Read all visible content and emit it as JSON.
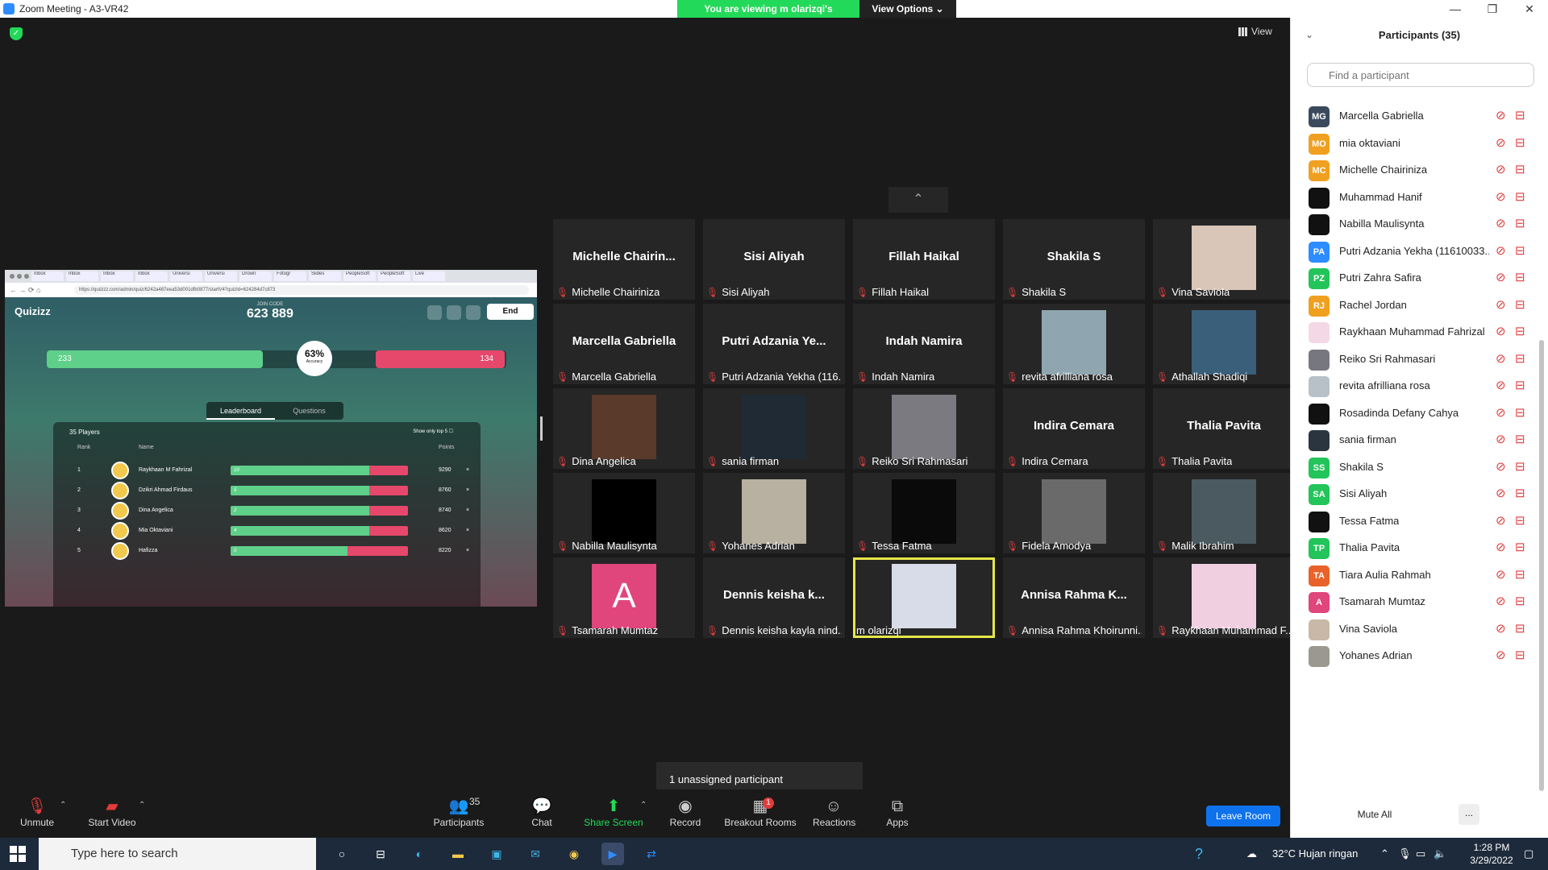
{
  "window": {
    "title": "Zoom Meeting - A3-VR42",
    "controls": [
      "—",
      "❐",
      "✕"
    ]
  },
  "banner": {
    "viewing": "You are viewing m olarizqi's screen",
    "view_options": "View Options ⌄"
  },
  "view_button": "View",
  "shared_screen": {
    "browser_tabs": [
      "Inbox",
      "Inbox",
      "Inbox",
      "Inbox",
      "Universi",
      "Universi",
      "Drown",
      "Fotogr",
      "Slides",
      "PeopleSoft",
      "PeopleSoft",
      "Live"
    ],
    "url": "https://quizizz.com/admin/quiz/6242a487eea53d001dfb0877/startV4?quizId=624284d7c873",
    "quiz": {
      "logo": "Quizizz",
      "join_label": "JOIN CODE",
      "join_code": "623 889",
      "end_label": "End",
      "correct_count": "233",
      "incorrect_count": "134",
      "accuracy": "63%",
      "accuracy_label": "Accuracy",
      "correct_fraction": 0.63,
      "tab_leaderboard": "Leaderboard",
      "tab_questions": "Questions",
      "players": "35 Players",
      "show_top5": "Show only top 5",
      "col_rank": "Rank",
      "col_name": "Name",
      "col_points": "Points",
      "rows": [
        {
          "rank": "1",
          "name": "Raykhaan M Fahrizal",
          "score": "10",
          "fraction": 0.78,
          "points": "9290",
          "x": "×"
        },
        {
          "rank": "2",
          "name": "Dzikri Ahmad Firdaus",
          "score": "5",
          "fraction": 0.78,
          "points": "8760",
          "x": "×"
        },
        {
          "rank": "3",
          "name": "Dina Angelica",
          "score": "2",
          "fraction": 0.78,
          "points": "8740",
          "x": "×"
        },
        {
          "rank": "4",
          "name": "Mia Oktaviani",
          "score": "4",
          "fraction": 0.78,
          "points": "8620",
          "x": "×"
        },
        {
          "rank": "5",
          "name": "Hafizza",
          "score": "0",
          "fraction": 0.66,
          "points": "8220",
          "x": "×"
        }
      ]
    }
  },
  "grid_up": "⌃",
  "tiles": [
    {
      "big": "Michelle  Chairin...",
      "label": "Michelle Chairiniza",
      "pic": ""
    },
    {
      "big": "Sisi Aliyah",
      "label": "Sisi Aliyah",
      "pic": ""
    },
    {
      "big": "Fillah Haikal",
      "label": "Fillah Haikal",
      "pic": ""
    },
    {
      "big": "Shakila S",
      "label": "Shakila S",
      "pic": ""
    },
    {
      "big": "",
      "label": "Vina Saviola",
      "pic": "#d9c6b8"
    },
    {
      "big": "Marcella Gabriella",
      "label": "Marcella Gabriella",
      "pic": ""
    },
    {
      "big": "Putri  Adzania  Ye...",
      "label": "Putri Adzania Yekha (116...",
      "pic": ""
    },
    {
      "big": "Indah Namira",
      "label": "Indah Namira",
      "pic": ""
    },
    {
      "big": "",
      "label": "revita afrilliana rosa",
      "pic": "#8fa6b0"
    },
    {
      "big": "",
      "label": "Athallah Shadiqi",
      "pic": "#3a5f7a"
    },
    {
      "big": "",
      "label": "Dina Angelica",
      "pic": "#5a3a2a"
    },
    {
      "big": "",
      "label": "sania firman",
      "pic": "#202a35"
    },
    {
      "big": "",
      "label": "Reiko Sri Rahmasari",
      "pic": "#7a7a80"
    },
    {
      "big": "Indira Cemara",
      "label": "Indira Cemara",
      "pic": ""
    },
    {
      "big": "Thalia Pavita",
      "label": "Thalia Pavita",
      "pic": ""
    },
    {
      "big": "",
      "label": "Nabilla Maulisynta",
      "pic": "#000000"
    },
    {
      "big": "",
      "label": "Yohanes Adrian",
      "pic": "#b8b0a0"
    },
    {
      "big": "",
      "label": "Tessa Fatma",
      "pic": "#0a0a0a"
    },
    {
      "big": "",
      "label": "Fidela Amodya",
      "pic": "#6a6a6a"
    },
    {
      "big": "",
      "label": "Malik Ibrahim",
      "pic": "#4a5a60"
    },
    {
      "big": "",
      "label": "Tsamarah Mumtaz",
      "pic": "#e0457b",
      "letter": "A"
    },
    {
      "big": "Dennis  keisha  k...",
      "label": "Dennis keisha kayla nind...",
      "pic": ""
    },
    {
      "big": "",
      "label": "m olarizqi",
      "pic": "#d8dce8",
      "active": true
    },
    {
      "big": "Annisa  Rahma  K...",
      "label": "Annisa Rahma Khoirunni...",
      "pic": ""
    },
    {
      "big": "",
      "label": "Raykhaan Muhammad F...",
      "pic": "#f0d0e0"
    }
  ],
  "notice": "1 unassigned participant",
  "toolbar": {
    "unmute": "Unmute",
    "start_video": "Start Video",
    "participants": "Participants",
    "participants_count": "35",
    "chat": "Chat",
    "share_screen": "Share Screen",
    "record": "Record",
    "breakout": "Breakout Rooms",
    "breakout_badge": "1",
    "reactions": "Reactions",
    "apps": "Apps",
    "leave": "Leave Room"
  },
  "panel": {
    "title": "Participants (35)",
    "search_placeholder": "Find a participant",
    "mute_all": "Mute All",
    "more": "...",
    "participants": [
      {
        "name": "Marcella Gabriella",
        "initials": "MG",
        "color": "#3a4a5c"
      },
      {
        "name": "mia oktaviani",
        "initials": "MO",
        "color": "#f0a020"
      },
      {
        "name": "Michelle Chairiniza",
        "initials": "MC",
        "color": "#f0a020"
      },
      {
        "name": "Muhammad Hanif",
        "initials": "",
        "color": "#111111"
      },
      {
        "name": "Nabilla Maulisynta",
        "initials": "",
        "color": "#111111"
      },
      {
        "name": "Putri Adzania Yekha (11610033...",
        "initials": "PA",
        "color": "#2d8cff"
      },
      {
        "name": "Putri Zahra Safira",
        "initials": "PZ",
        "color": "#23c45a"
      },
      {
        "name": "Rachel Jordan",
        "initials": "RJ",
        "color": "#f0a020"
      },
      {
        "name": "Raykhaan Muhammad Fahrizal",
        "initials": "",
        "color": "#f4d8e6"
      },
      {
        "name": "Reiko Sri Rahmasari",
        "initials": "",
        "color": "#777780"
      },
      {
        "name": "revita afrilliana rosa",
        "initials": "",
        "color": "#b8c0c8"
      },
      {
        "name": "Rosadinda Defany Cahya",
        "initials": "",
        "color": "#111111"
      },
      {
        "name": "sania firman",
        "initials": "",
        "color": "#2a3540"
      },
      {
        "name": "Shakila S",
        "initials": "SS",
        "color": "#23c45a"
      },
      {
        "name": "Sisi Aliyah",
        "initials": "SA",
        "color": "#23c45a"
      },
      {
        "name": "Tessa Fatma",
        "initials": "",
        "color": "#111111"
      },
      {
        "name": "Thalia Pavita",
        "initials": "TP",
        "color": "#23c45a"
      },
      {
        "name": "Tiara Aulia Rahmah",
        "initials": "TA",
        "color": "#e8622a"
      },
      {
        "name": "Tsamarah Mumtaz",
        "initials": "A",
        "color": "#e0457b"
      },
      {
        "name": "Vina Saviola",
        "initials": "",
        "color": "#c9b8a8"
      },
      {
        "name": "Yohanes Adrian",
        "initials": "",
        "color": "#9a9890"
      }
    ]
  },
  "taskbar": {
    "search_placeholder": "Type here to search",
    "weather": "32°C  Hujan ringan",
    "time": "1:28 PM",
    "date": "3/29/2022"
  }
}
